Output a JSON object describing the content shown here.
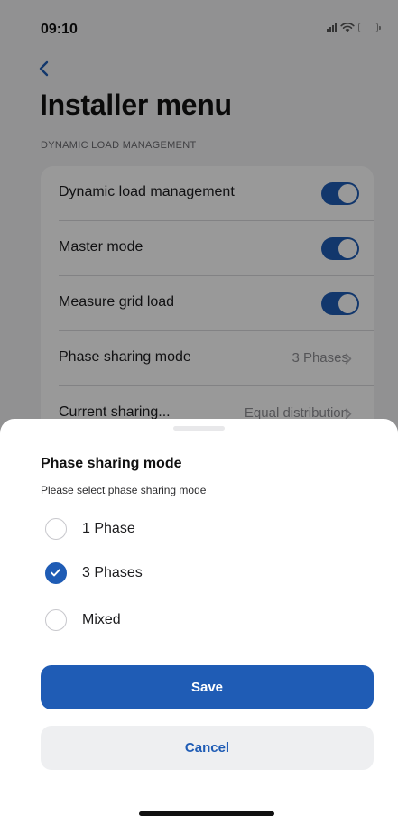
{
  "status_bar": {
    "time": "09:10",
    "icons": [
      "signal-icon",
      "wifi-icon",
      "battery-icon"
    ],
    "battery_color": "#ffd60a"
  },
  "header": {
    "back_icon": "chevron-left-icon",
    "title": "Installer menu"
  },
  "section": {
    "label": "DYNAMIC LOAD MANAGEMENT",
    "rows": [
      {
        "label": "Dynamic load management",
        "type": "toggle",
        "on": true
      },
      {
        "label": "Master mode",
        "type": "toggle",
        "on": true
      },
      {
        "label": "Measure grid load",
        "type": "toggle",
        "on": true
      },
      {
        "label": "Phase sharing mode",
        "type": "link",
        "value": "3 Phases"
      },
      {
        "label": "Current sharing...",
        "type": "link",
        "value": "Equal distribution"
      }
    ]
  },
  "sheet": {
    "title": "Phase sharing mode",
    "subtitle": "Please select phase sharing mode",
    "options": [
      {
        "label": "1 Phase",
        "selected": false
      },
      {
        "label": "3 Phases",
        "selected": true
      },
      {
        "label": "Mixed",
        "selected": false
      }
    ],
    "save_label": "Save",
    "cancel_label": "Cancel"
  },
  "colors": {
    "accent": "#1f5cb5",
    "background": "#f2f2f4",
    "overlay": "rgba(0,0,0,0.4)"
  }
}
